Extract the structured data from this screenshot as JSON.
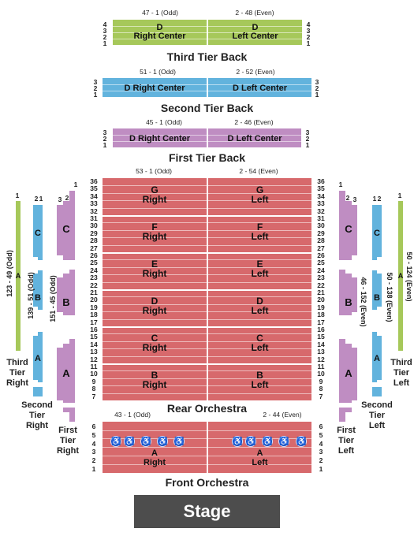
{
  "colors": {
    "third_tier": "#a6c85a",
    "second_tier": "#62b3dd",
    "first_tier": "#bf8dc2",
    "orchestra": "#d7696c",
    "stage": "#4d4d4d",
    "wheelchair": "#1f4fbf"
  },
  "third_tier_back": {
    "title": "Third Tier Back",
    "range_left": "47 - 1 (Odd)",
    "range_right": "2 - 48 (Even)",
    "rows": [
      "4",
      "3",
      "2",
      "1"
    ],
    "left_section": {
      "letter": "D",
      "name": "Right Center"
    },
    "right_section": {
      "letter": "D",
      "name": "Left Center"
    }
  },
  "second_tier_back": {
    "title": "Second Tier Back",
    "range_left": "51 - 1 (Odd)",
    "range_right": "2 - 52 (Even)",
    "rows": [
      "3",
      "2",
      "1"
    ],
    "left_section": {
      "name": "D Right Center"
    },
    "right_section": {
      "name": "D Left Center"
    }
  },
  "first_tier_back": {
    "title": "First Tier Back",
    "range_left": "45 - 1 (Odd)",
    "range_right": "2 - 46 (Even)",
    "rows": [
      "3",
      "2",
      "1"
    ],
    "left_section": {
      "name": "D Right Center"
    },
    "right_section": {
      "name": "D Left Center"
    }
  },
  "rear_orchestra": {
    "title": "Rear Orchestra",
    "range_left": "53 - 1 (Odd)",
    "range_right": "2 - 54 (Even)",
    "rows": [
      "36",
      "35",
      "34",
      "33",
      "32",
      "31",
      "30",
      "29",
      "28",
      "27",
      "26",
      "25",
      "24",
      "23",
      "22",
      "21",
      "20",
      "19",
      "18",
      "17",
      "16",
      "15",
      "14",
      "13",
      "12",
      "11",
      "10",
      "9",
      "8",
      "7"
    ],
    "sections": [
      {
        "letter": "G",
        "right": "Right",
        "left": "Left"
      },
      {
        "letter": "F",
        "right": "Right",
        "left": "Left"
      },
      {
        "letter": "E",
        "right": "Right",
        "left": "Left"
      },
      {
        "letter": "D",
        "right": "Right",
        "left": "Left"
      },
      {
        "letter": "C",
        "right": "Right",
        "left": "Left"
      },
      {
        "letter": "B",
        "right": "Right",
        "left": "Left"
      }
    ]
  },
  "front_orchestra": {
    "title": "Front Orchestra",
    "range_left": "43 - 1 (Odd)",
    "range_right": "2 - 44 (Even)",
    "rows": [
      "6",
      "5",
      "4",
      "3",
      "2",
      "1"
    ],
    "left_section": {
      "letter": "A",
      "name": "Right"
    },
    "right_section": {
      "letter": "A",
      "name": "Left"
    },
    "wheelchair_icon": "♿",
    "wheelchair_count_each_side": 5
  },
  "stage": {
    "label": "Stage"
  },
  "side_right": {
    "third_tier": {
      "label_lines": [
        "Third",
        "Tier",
        "Right"
      ],
      "range": "123 - 49 (Odd)",
      "row": "1",
      "section": "A"
    },
    "second_tier": {
      "label_lines": [
        "Second",
        "Tier",
        "Right"
      ],
      "range": "139 - 51 (Odd)",
      "rows": [
        "2",
        "1"
      ],
      "sections": [
        "C",
        "B",
        "A"
      ]
    },
    "first_tier": {
      "label_lines": [
        "First",
        "Tier",
        "Right"
      ],
      "range": "151 - 45 (Odd)",
      "rows": [
        "3",
        "2",
        "1"
      ],
      "sections": [
        "C",
        "B",
        "A"
      ]
    }
  },
  "side_left": {
    "third_tier": {
      "label_lines": [
        "Third",
        "Tier",
        "Left"
      ],
      "range": "50 - 124 (Even)",
      "row": "1",
      "section": "A"
    },
    "second_tier": {
      "label_lines": [
        "Second",
        "Tier",
        "Left"
      ],
      "range": "50 - 138 (Even)",
      "rows": [
        "1",
        "2"
      ],
      "sections": [
        "C",
        "B",
        "A"
      ]
    },
    "first_tier": {
      "label_lines": [
        "First",
        "Tier",
        "Left"
      ],
      "range": "46 - 152 (Even)",
      "rows": [
        "1",
        "2",
        "3"
      ],
      "sections": [
        "C",
        "B",
        "A"
      ]
    }
  }
}
